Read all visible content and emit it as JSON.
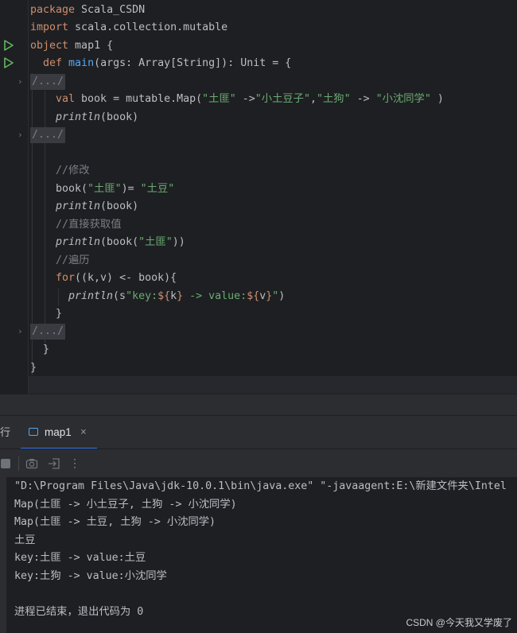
{
  "editor": {
    "lines": {
      "l1_kw": "package",
      "l1_rest": " Scala_CSDN",
      "l2_kw": "import",
      "l2_rest": " scala.collection.mutable",
      "l3_kw": "object",
      "l3_rest": " map1 {",
      "l4_kw": "def",
      "l4_fn": "main",
      "l4_rest": "(args: Array[String]): Unit = {",
      "fold1": "/.../",
      "l6_kw": "val",
      "l6_a": " book = mutable.Map(",
      "l6_s1": "\"土匪\"",
      "l6_b": " ->",
      "l6_s2": "\"小土豆子\"",
      "l6_c": ",",
      "l6_s3": "\"土狗\"",
      "l6_d": " -> ",
      "l6_s4": "\"小沈同学\"",
      "l6_e": " )",
      "l7_fn": "println",
      "l7_rest": "(book)",
      "fold2": "/.../",
      "l10_cmt": "//修改",
      "l11_a": "book(",
      "l11_s1": "\"土匪\"",
      "l11_b": ")= ",
      "l11_s2": "\"土豆\"",
      "l12_fn": "println",
      "l12_rest": "(book)",
      "l13_cmt": "//直接获取值",
      "l14_fn": "println",
      "l14_a": "(book(",
      "l14_s": "\"土匪\"",
      "l14_b": "))",
      "l15_cmt": "//遍历",
      "l16_kw": "for",
      "l16_rest": "((k,v) <- book){",
      "l17_fn": "println",
      "l17_a": "(s",
      "l17_s1": "\"key:",
      "l17_d1": "${",
      "l17_v1": "k",
      "l17_d2": "}",
      "l17_s2": " -> value:",
      "l17_d3": "${",
      "l17_v2": "v",
      "l17_d4": "}",
      "l17_s3": "\"",
      "l17_b": ")",
      "l18": "}",
      "fold3": "/.../",
      "l20": "}",
      "l21": "}"
    }
  },
  "run_panel": {
    "label": "行",
    "tab_label": "map1",
    "tab_close": "×",
    "icons": [
      "stop-icon",
      "camera-icon",
      "restore-layout-icon",
      "more-icon"
    ],
    "more": "⋮"
  },
  "console": {
    "lines": [
      "\"D:\\Program Files\\Java\\jdk-10.0.1\\bin\\java.exe\" \"-javaagent:E:\\新建文件夹\\Intel",
      "Map(土匪 -> 小土豆子, 土狗 -> 小沈同学)",
      "Map(土匪 -> 土豆, 土狗 -> 小沈同学)",
      "土豆",
      "key:土匪 -> value:土豆",
      "key:土狗 -> value:小沈同学",
      "",
      "进程已结束，退出代码为 0"
    ]
  },
  "watermark": "CSDN @今天我又学废了",
  "colors": {
    "keyword": "#cf8e6d",
    "function": "#56a8f5",
    "string": "#6aab73",
    "comment": "#7a7e85",
    "accent": "#3574f0",
    "run": "#5fb85f"
  }
}
